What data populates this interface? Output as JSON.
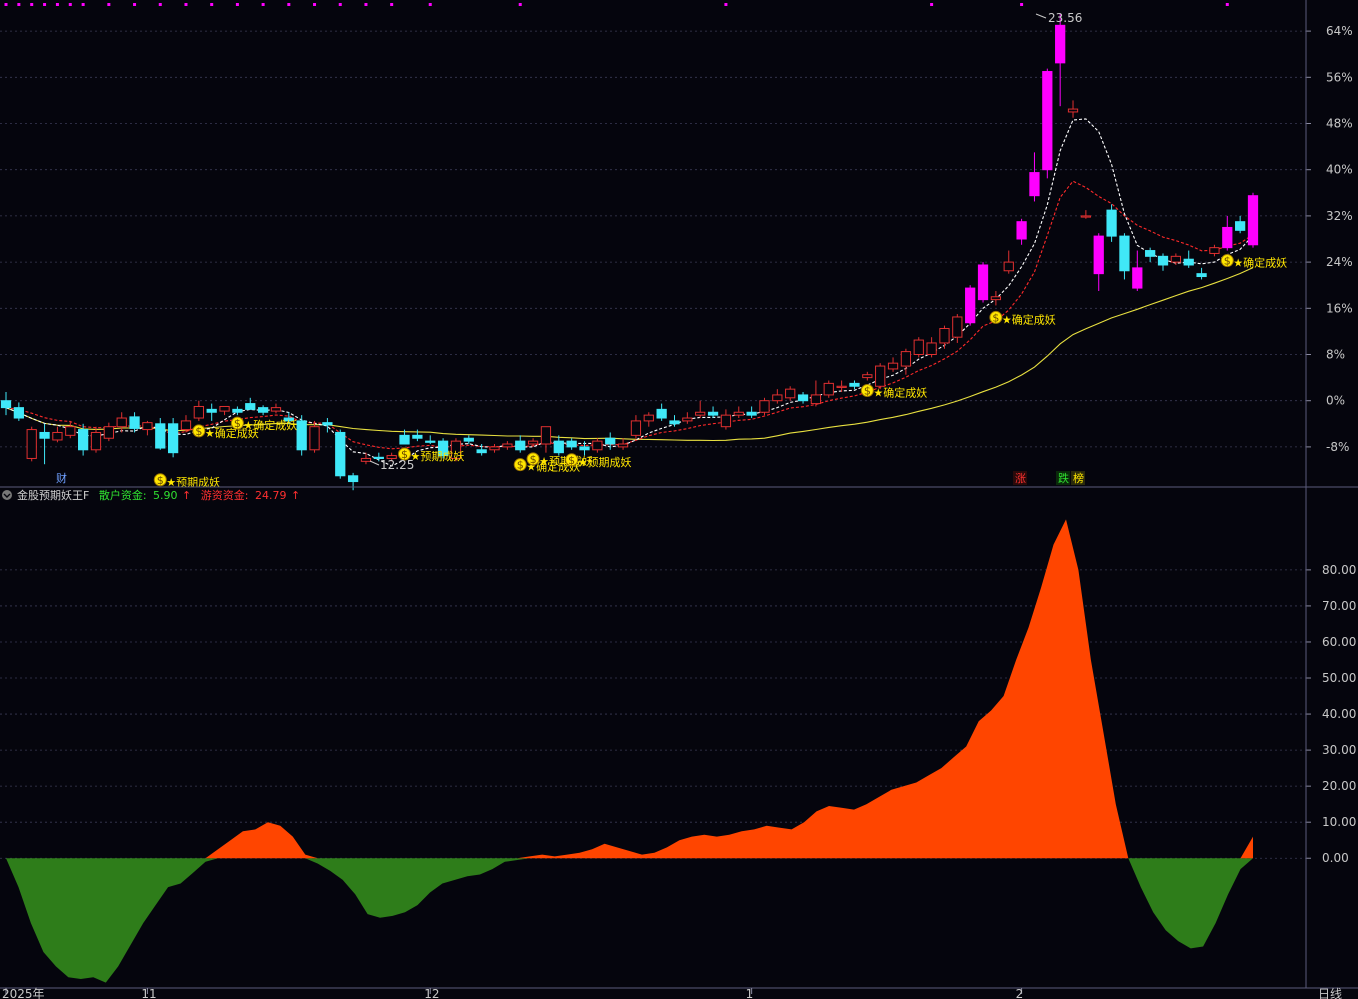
{
  "indicator": {
    "name": "金股预期妖王F",
    "retail_label": "散户资金:",
    "retail_value": "5.90",
    "hot_label": "游资资金:",
    "hot_value": "24.79",
    "arrow": "↑"
  },
  "x_labels": [
    "2025年",
    "11",
    "12",
    "1",
    "2"
  ],
  "period_label": "日线",
  "markers": {
    "cai": "财",
    "zhang": "涨",
    "die": "跌",
    "bang": "榜"
  },
  "price_high_label": "23.56",
  "price_low_label": "12.25",
  "colors": {
    "background": "#05050d",
    "grid": "#3a3a55",
    "up_magenta": "#ff00ff",
    "up_red": "#e03030",
    "down_cyan": "#40e8f8",
    "ma_white": "#ffffff",
    "ma_red": "#ff2a2a",
    "ma_yellow": "#e8e040",
    "fill_positive": "#ff4500",
    "fill_negative": "#2e7d1a",
    "signal_yellow": "#ffe600"
  },
  "chart_data": [
    {
      "type": "candlestick",
      "y_axis_unit": "percent change",
      "ylim": [
        -12,
        68
      ],
      "y_ticks": [
        64,
        56,
        48,
        40,
        32,
        24,
        16,
        8,
        0,
        -8
      ],
      "y_tick_labels": [
        "64%",
        "56%",
        "48%",
        "40%",
        "32%",
        "24%",
        "16%",
        "8%",
        "0%",
        "-8%"
      ],
      "candles": [
        {
          "o": 0.0,
          "h": 1.5,
          "l": -2.5,
          "c": -1.2
        },
        {
          "o": -1.2,
          "h": -0.3,
          "l": -3.5,
          "c": -3.0
        },
        {
          "o": -10.0,
          "h": -4.5,
          "l": -10.5,
          "c": -5.0
        },
        {
          "o": -5.5,
          "h": -4.0,
          "l": -11.0,
          "c": -6.5
        },
        {
          "o": -6.8,
          "h": -4.5,
          "l": -7.2,
          "c": -5.5
        },
        {
          "o": -6.0,
          "h": -3.5,
          "l": -6.5,
          "c": -4.5
        },
        {
          "o": -5.0,
          "h": -4.0,
          "l": -9.5,
          "c": -8.5
        },
        {
          "o": -8.5,
          "h": -4.5,
          "l": -9.0,
          "c": -5.5
        },
        {
          "o": -6.5,
          "h": -3.8,
          "l": -7.0,
          "c": -4.5
        },
        {
          "o": -4.5,
          "h": -2.0,
          "l": -5.5,
          "c": -3.0
        },
        {
          "o": -2.8,
          "h": -2.0,
          "l": -5.5,
          "c": -4.8
        },
        {
          "o": -5.0,
          "h": -3.5,
          "l": -6.0,
          "c": -3.8
        },
        {
          "o": -4.0,
          "h": -3.0,
          "l": -8.5,
          "c": -8.2
        },
        {
          "o": -4.0,
          "h": -3.0,
          "l": -9.8,
          "c": -9.0
        },
        {
          "o": -5.0,
          "h": -2.5,
          "l": -5.5,
          "c": -3.5
        },
        {
          "o": -3.0,
          "h": 0.0,
          "l": -3.5,
          "c": -1.0
        },
        {
          "o": -1.5,
          "h": -0.5,
          "l": -3.5,
          "c": -2.0
        },
        {
          "o": -1.8,
          "h": -1.0,
          "l": -2.5,
          "c": -1.0
        },
        {
          "o": -1.5,
          "h": -1.0,
          "l": -2.5,
          "c": -2.0
        },
        {
          "o": -0.5,
          "h": 0.5,
          "l": -1.5,
          "c": -1.5
        },
        {
          "o": -1.2,
          "h": -0.8,
          "l": -2.5,
          "c": -2.0
        },
        {
          "o": -1.8,
          "h": -0.5,
          "l": -2.2,
          "c": -1.2
        },
        {
          "o": -3.0,
          "h": -2.0,
          "l": -4.0,
          "c": -3.5
        },
        {
          "o": -3.5,
          "h": -2.5,
          "l": -9.5,
          "c": -8.5
        },
        {
          "o": -8.5,
          "h": -3.5,
          "l": -9.0,
          "c": -4.5
        },
        {
          "o": -3.8,
          "h": -3.0,
          "l": -5.5,
          "c": -4.2
        },
        {
          "o": -5.5,
          "h": -5.0,
          "l": -13.5,
          "c": -13.0
        },
        {
          "o": -13.0,
          "h": -12.5,
          "l": -15.5,
          "c": -14.0
        },
        {
          "o": -10.5,
          "h": -9.0,
          "l": -11.0,
          "c": -10.0
        },
        {
          "o": -9.8,
          "h": -9.0,
          "l": -10.5,
          "c": -10.0
        },
        {
          "o": -10.0,
          "h": -9.0,
          "l": -10.5,
          "c": -9.5
        },
        {
          "o": -6.0,
          "h": -5.0,
          "l": -7.5,
          "c": -7.5
        },
        {
          "o": -6.0,
          "h": -5.0,
          "l": -7.0,
          "c": -6.5
        },
        {
          "o": -7.0,
          "h": -6.0,
          "l": -7.5,
          "c": -7.2
        },
        {
          "o": -7.0,
          "h": -6.5,
          "l": -10.0,
          "c": -9.5
        },
        {
          "o": -10.0,
          "h": -6.5,
          "l": -10.5,
          "c": -7.0
        },
        {
          "o": -6.5,
          "h": -6.0,
          "l": -7.5,
          "c": -7.0
        },
        {
          "o": -8.5,
          "h": -7.5,
          "l": -9.5,
          "c": -9.0
        },
        {
          "o": -8.5,
          "h": -7.5,
          "l": -9.0,
          "c": -8.0
        },
        {
          "o": -8.0,
          "h": -7.0,
          "l": -8.5,
          "c": -7.5
        },
        {
          "o": -7.0,
          "h": -6.0,
          "l": -9.0,
          "c": -8.5
        },
        {
          "o": -7.5,
          "h": -6.5,
          "l": -8.0,
          "c": -7.0
        },
        {
          "o": -7.5,
          "h": -4.5,
          "l": -9.0,
          "c": -4.5
        },
        {
          "o": -7.0,
          "h": -6.0,
          "l": -9.5,
          "c": -9.0
        },
        {
          "o": -7.0,
          "h": -6.5,
          "l": -8.5,
          "c": -8.0
        },
        {
          "o": -8.0,
          "h": -7.0,
          "l": -9.5,
          "c": -8.5
        },
        {
          "o": -8.5,
          "h": -6.5,
          "l": -9.0,
          "c": -7.0
        },
        {
          "o": -6.5,
          "h": -5.5,
          "l": -8.5,
          "c": -7.5
        },
        {
          "o": -8.0,
          "h": -6.5,
          "l": -8.5,
          "c": -7.5
        },
        {
          "o": -6.0,
          "h": -2.5,
          "l": -6.5,
          "c": -3.5
        },
        {
          "o": -3.5,
          "h": -2.0,
          "l": -4.5,
          "c": -2.5
        },
        {
          "o": -1.5,
          "h": -0.5,
          "l": -3.5,
          "c": -3.0
        },
        {
          "o": -3.5,
          "h": -2.5,
          "l": -4.5,
          "c": -4.0
        },
        {
          "o": -3.5,
          "h": -2.0,
          "l": -4.0,
          "c": -3.0
        },
        {
          "o": -2.5,
          "h": 0.0,
          "l": -3.0,
          "c": -2.0
        },
        {
          "o": -2.0,
          "h": -1.0,
          "l": -3.0,
          "c": -2.5
        },
        {
          "o": -4.5,
          "h": -1.5,
          "l": -5.0,
          "c": -2.5
        },
        {
          "o": -2.5,
          "h": -1.0,
          "l": -3.0,
          "c": -2.0
        },
        {
          "o": -2.0,
          "h": -1.0,
          "l": -3.0,
          "c": -2.5
        },
        {
          "o": -2.0,
          "h": 0.5,
          "l": -2.5,
          "c": 0.0
        },
        {
          "o": 0.0,
          "h": 2.0,
          "l": -0.5,
          "c": 1.0
        },
        {
          "o": 0.5,
          "h": 2.5,
          "l": 0.0,
          "c": 2.0
        },
        {
          "o": 1.0,
          "h": 1.5,
          "l": -0.5,
          "c": 0.0
        },
        {
          "o": -0.5,
          "h": 3.5,
          "l": -1.0,
          "c": 1.0
        },
        {
          "o": 1.0,
          "h": 3.5,
          "l": 0.5,
          "c": 3.0
        },
        {
          "o": 2.5,
          "h": 3.5,
          "l": 1.5,
          "c": 2.5
        },
        {
          "o": 3.0,
          "h": 3.5,
          "l": 2.0,
          "c": 2.5
        },
        {
          "o": 4.0,
          "h": 5.0,
          "l": 3.5,
          "c": 4.5
        },
        {
          "o": 2.5,
          "h": 6.5,
          "l": 2.0,
          "c": 6.0
        },
        {
          "o": 5.5,
          "h": 7.5,
          "l": 5.0,
          "c": 6.5
        },
        {
          "o": 6.0,
          "h": 9.0,
          "l": 4.5,
          "c": 8.5
        },
        {
          "o": 8.0,
          "h": 11.0,
          "l": 7.5,
          "c": 10.5
        },
        {
          "o": 8.0,
          "h": 11.0,
          "l": 7.5,
          "c": 10.0
        },
        {
          "o": 10.0,
          "h": 13.0,
          "l": 9.0,
          "c": 12.5
        },
        {
          "o": 11.0,
          "h": 15.0,
          "l": 10.0,
          "c": 14.5
        },
        {
          "o": 13.5,
          "h": 20.0,
          "l": 13.0,
          "c": 19.5
        },
        {
          "o": 17.5,
          "h": 24.0,
          "l": 17.0,
          "c": 23.5
        },
        {
          "o": 17.5,
          "h": 19.0,
          "l": 16.5,
          "c": 18.0
        },
        {
          "o": 22.5,
          "h": 26.0,
          "l": 22.0,
          "c": 24.0
        },
        {
          "o": 28.0,
          "h": 31.5,
          "l": 27.0,
          "c": 31.0
        },
        {
          "o": 35.5,
          "h": 43.0,
          "l": 34.5,
          "c": 39.5
        },
        {
          "o": 40.0,
          "h": 57.5,
          "l": 38.5,
          "c": 57.0
        },
        {
          "o": 58.5,
          "h": 67.0,
          "l": 51.0,
          "c": 65.0
        },
        {
          "o": 50.0,
          "h": 52.0,
          "l": 49.0,
          "c": 50.5
        },
        {
          "o": 32.0,
          "h": 33.0,
          "l": 31.5,
          "c": 32.0
        },
        {
          "o": 22.0,
          "h": 29.0,
          "l": 19.0,
          "c": 28.5
        },
        {
          "o": 33.0,
          "h": 34.0,
          "l": 27.5,
          "c": 28.5
        },
        {
          "o": 28.5,
          "h": 29.0,
          "l": 21.0,
          "c": 22.5
        },
        {
          "o": 19.5,
          "h": 26.0,
          "l": 19.0,
          "c": 23.0
        },
        {
          "o": 26.0,
          "h": 26.5,
          "l": 24.0,
          "c": 25.0
        },
        {
          "o": 25.0,
          "h": 25.5,
          "l": 22.5,
          "c": 23.5
        },
        {
          "o": 24.0,
          "h": 25.5,
          "l": 23.5,
          "c": 25.0
        },
        {
          "o": 24.5,
          "h": 26.0,
          "l": 23.0,
          "c": 23.5
        },
        {
          "o": 22.0,
          "h": 23.0,
          "l": 21.0,
          "c": 21.5
        },
        {
          "o": 25.5,
          "h": 27.0,
          "l": 25.0,
          "c": 26.5
        },
        {
          "o": 26.5,
          "h": 32.0,
          "l": 26.0,
          "c": 30.0
        },
        {
          "o": 31.0,
          "h": 32.0,
          "l": 29.0,
          "c": 29.5
        },
        {
          "o": 27.0,
          "h": 36.0,
          "l": 26.5,
          "c": 35.5
        }
      ],
      "annotations": [
        "预期成妖",
        "确定成妖"
      ]
    },
    {
      "type": "area",
      "series": [
        {
          "name": "游资资金",
          "values": [
            0.0,
            -8.0,
            -18.0,
            -26.0,
            -30.0,
            -33.0,
            -33.5,
            -33.0,
            -34.5,
            -30.0,
            -24.0,
            -18.0,
            -13.0,
            -8.0,
            -7.0,
            -4.0,
            -1.0,
            2.5,
            5.0,
            7.5,
            8.0,
            10.0,
            9.0,
            6.0,
            1.0,
            -1.5,
            -3.5,
            -6.0,
            -10.0,
            -15.5,
            -16.5,
            -16.0,
            -15.0,
            -13.0,
            -9.5,
            -7.0,
            -6.0,
            -5.0,
            -4.5,
            -3.0,
            -1.0,
            -0.5,
            0.5,
            1.0,
            0.5,
            1.0,
            1.5,
            2.5,
            4.0,
            3.0,
            2.0,
            1.0,
            1.5,
            3.0,
            5.0,
            6.0,
            6.5,
            6.0,
            6.5,
            7.5,
            8.0,
            9.0,
            8.5,
            8.0,
            10.0,
            13.0,
            14.5,
            14.0,
            13.5,
            15.0,
            17.0,
            19.0,
            20.0,
            21.0,
            23.0,
            25.0,
            28.0,
            31.0,
            38.0,
            41.0,
            45.0,
            55.0,
            64.0,
            75.0,
            87.0,
            94.0,
            80.0,
            55.0,
            35.0,
            15.0,
            0.0,
            -8.0,
            -15.0,
            -20.0,
            -23.0,
            -25.0,
            -24.5,
            -18.0,
            -10.0,
            -3.0,
            6.0
          ]
        }
      ],
      "ylim": [
        -36,
        98
      ],
      "y_ticks": [
        80,
        70,
        60,
        50,
        40,
        30,
        20,
        10,
        0
      ],
      "y_tick_labels": [
        "80.00",
        "70.00",
        "60.00",
        "50.00",
        "40.00",
        "30.00",
        "20.00",
        "10.00",
        "0.00"
      ]
    }
  ]
}
